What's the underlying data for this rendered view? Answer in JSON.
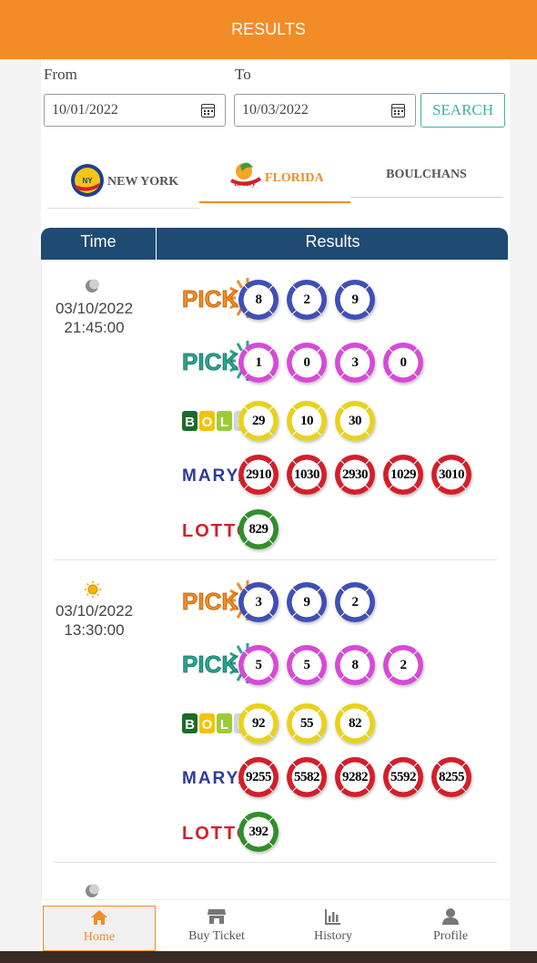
{
  "header": {
    "title": "RESULTS"
  },
  "filters": {
    "from_label": "From",
    "to_label": "To",
    "from_value": "10/01/2022",
    "to_value": "10/03/2022",
    "search_label": "SEARCH",
    "accent": "#3fb0a3"
  },
  "tabs": [
    {
      "label": "NEW YORK",
      "active": false
    },
    {
      "label": "FLORIDA",
      "active": true
    },
    {
      "label": "BOULCHANS",
      "active": false
    }
  ],
  "table": {
    "col_time": "Time",
    "col_results": "Results",
    "header_color": "#1f4a73"
  },
  "draws": [
    {
      "icon": "moon-icon",
      "date": "03/10/2022",
      "time": "21:45:00",
      "games": [
        {
          "name": "PICK3",
          "color": "blue",
          "numbers": [
            "8",
            "2",
            "9"
          ]
        },
        {
          "name": "PICK4",
          "color": "pink",
          "numbers": [
            "1",
            "0",
            "3",
            "0"
          ]
        },
        {
          "name": "BOLET",
          "color": "yellow",
          "numbers": [
            "29",
            "10",
            "30"
          ]
        },
        {
          "name": "MARYAJ",
          "color": "red",
          "numbers": [
            "2910",
            "1030",
            "2930",
            "1029",
            "3010"
          ]
        },
        {
          "name": "LOTTO3",
          "color": "green",
          "numbers": [
            "829"
          ]
        }
      ]
    },
    {
      "icon": "sun-icon",
      "date": "03/10/2022",
      "time": "13:30:00",
      "games": [
        {
          "name": "PICK3",
          "color": "blue",
          "numbers": [
            "3",
            "9",
            "2"
          ]
        },
        {
          "name": "PICK4",
          "color": "pink",
          "numbers": [
            "5",
            "5",
            "8",
            "2"
          ]
        },
        {
          "name": "BOLET",
          "color": "yellow",
          "numbers": [
            "92",
            "55",
            "82"
          ]
        },
        {
          "name": "MARYAJ",
          "color": "red",
          "numbers": [
            "9255",
            "5582",
            "9282",
            "5592",
            "8255"
          ]
        },
        {
          "name": "LOTTO3",
          "color": "green",
          "numbers": [
            "392"
          ]
        }
      ]
    }
  ],
  "bottom_nav": [
    {
      "label": "Home",
      "icon": "home-icon",
      "active": true
    },
    {
      "label": "Buy Ticket",
      "icon": "store-icon",
      "active": false
    },
    {
      "label": "History",
      "icon": "bar-chart-icon",
      "active": false
    },
    {
      "label": "Profile",
      "icon": "user-icon",
      "active": false
    }
  ],
  "colors": {
    "brand": "#f28c26",
    "nav_dark": "#1f4a73"
  }
}
